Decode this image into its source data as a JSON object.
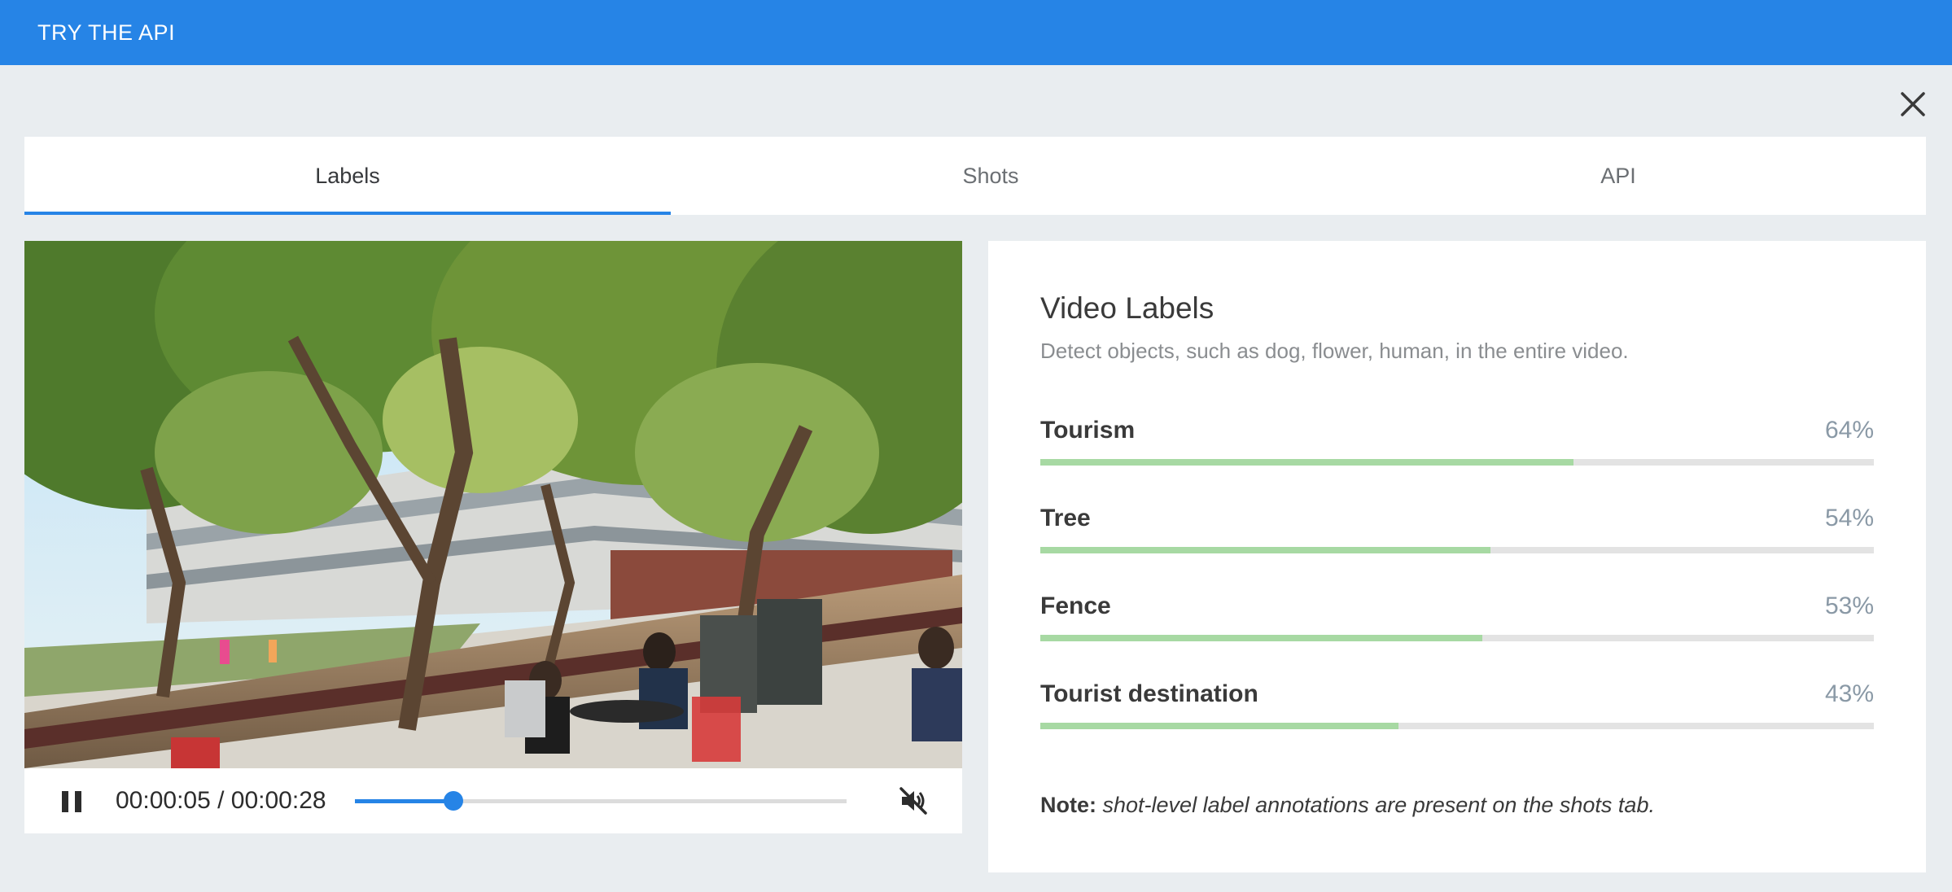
{
  "header": {
    "title": "TRY THE API"
  },
  "tabs": [
    {
      "label": "Labels",
      "active": true
    },
    {
      "label": "Shots",
      "active": false
    },
    {
      "label": "API",
      "active": false
    }
  ],
  "player": {
    "time_display": "00:00:05 / 00:00:28",
    "progress_fraction": 0.2,
    "state": "playing",
    "muted": true,
    "accent_color": "#2684e6"
  },
  "labels_panel": {
    "title": "Video Labels",
    "subtitle": "Detect objects, such as dog, flower, human, in the entire video.",
    "items": [
      {
        "name": "Tourism",
        "percent_label": "64%",
        "value": 0.64
      },
      {
        "name": "Tree",
        "percent_label": "54%",
        "value": 0.54
      },
      {
        "name": "Fence",
        "percent_label": "53%",
        "value": 0.53
      },
      {
        "name": "Tourist destination",
        "percent_label": "43%",
        "value": 0.43
      }
    ],
    "bar_color": "#a7d9a3",
    "note_label": "Note:",
    "note_text": "shot-level label annotations are present on the shots tab."
  },
  "icons": {
    "close": "close-icon",
    "pause": "pause-icon",
    "mute": "volume-off-icon"
  }
}
